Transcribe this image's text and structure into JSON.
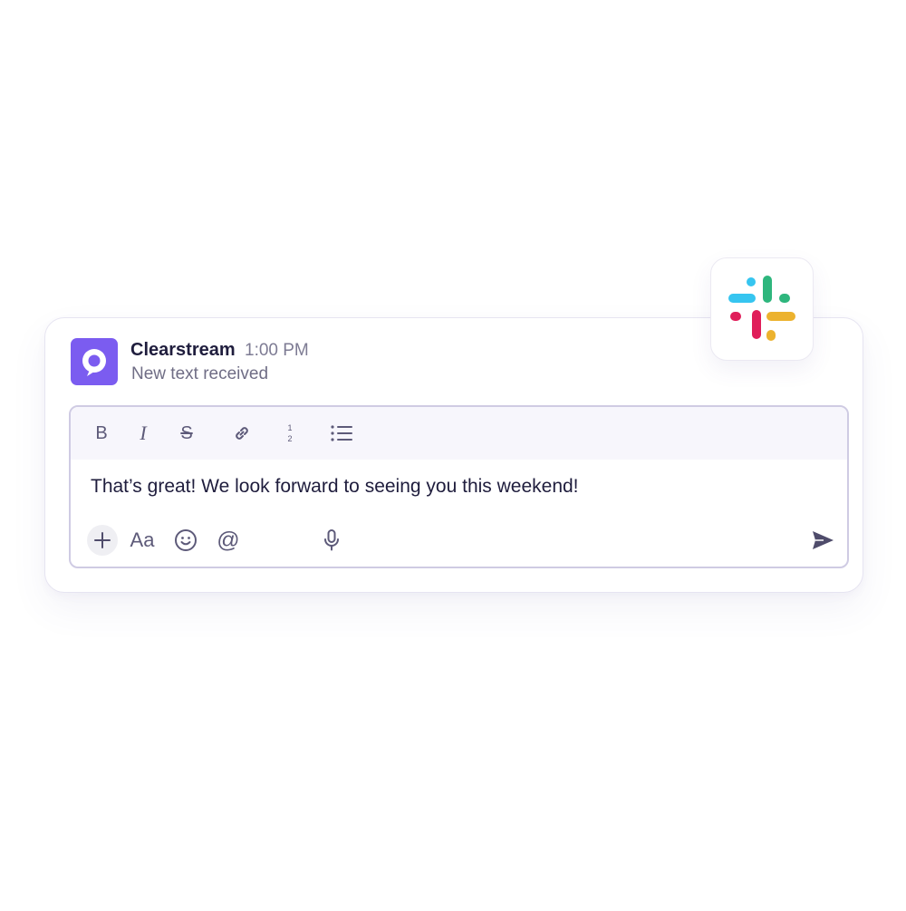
{
  "notification": {
    "sender": "Clearstream",
    "time": "1:00 PM",
    "subtitle": "New text received",
    "app_icon": "clearstream-logo",
    "app_color": "#7b5cf0"
  },
  "integration": {
    "icon": "slack-logo",
    "colors": [
      "#36c5f0",
      "#2eb67d",
      "#e01e5a",
      "#ecb22e"
    ]
  },
  "composer": {
    "message": "That’s great! We look forward to seeing you this weekend!",
    "toolbar": {
      "bold_label": "B",
      "italic_label": "I",
      "strike_label": "S",
      "link_icon": "link-icon",
      "ordered_list_icon": "ordered-list-icon",
      "bullet_list_icon": "bullet-list-icon"
    },
    "actions": {
      "attach_icon": "plus-icon",
      "format_label": "Aa",
      "emoji_icon": "emoji-icon",
      "mention_label": "@",
      "mic_icon": "microphone-icon",
      "send_icon": "send-icon"
    }
  }
}
